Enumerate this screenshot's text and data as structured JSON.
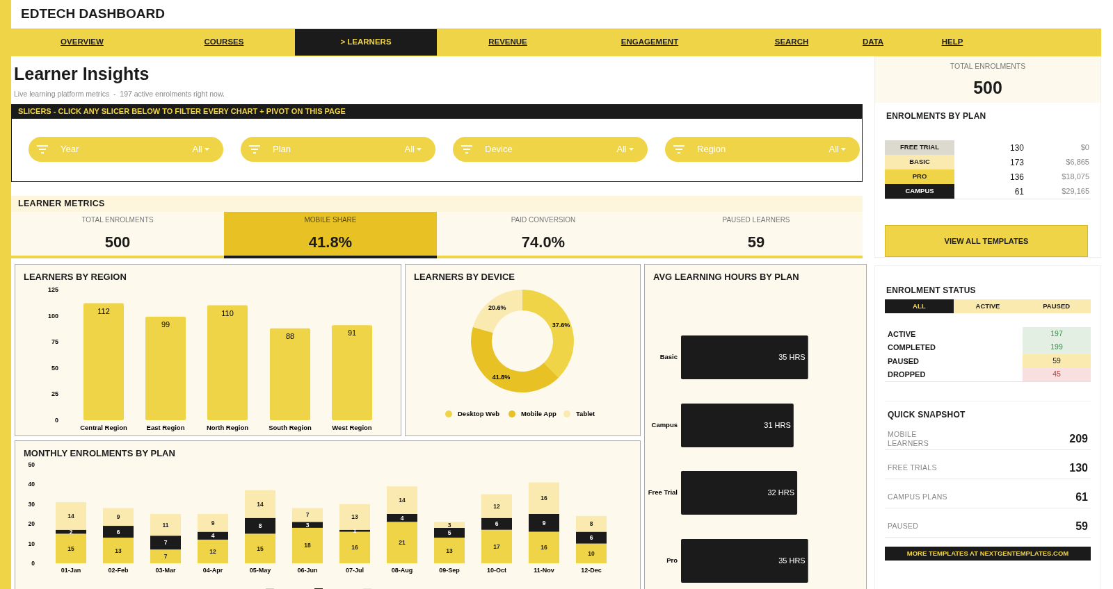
{
  "header": {
    "title": "EDTECH DASHBOARD"
  },
  "nav": [
    {
      "label": "OVERVIEW",
      "selected": false
    },
    {
      "label": "COURSES",
      "selected": false
    },
    {
      "label": "> LEARNERS",
      "selected": true
    },
    {
      "label": "REVENUE",
      "selected": false
    },
    {
      "label": "ENGAGEMENT",
      "selected": false
    },
    {
      "label": "SEARCH",
      "selected": false
    },
    {
      "label": "DATA",
      "selected": false
    },
    {
      "label": "HELP",
      "selected": false
    }
  ],
  "page": {
    "title": "Learner Insights",
    "subtitle": "Live learning platform metrics  -  197 active enrolments right now."
  },
  "slicers": {
    "heading": "SLICERS  -  CLICK ANY SLICER BELOW TO FILTER EVERY CHART + PIVOT ON THIS PAGE",
    "items": [
      {
        "label": "Year",
        "value": "All"
      },
      {
        "label": "Plan",
        "value": "All"
      },
      {
        "label": "Device",
        "value": "All"
      },
      {
        "label": "Region",
        "value": "All"
      }
    ]
  },
  "metrics": {
    "heading": "LEARNER METRICS",
    "tiles": [
      {
        "label": "TOTAL ENROLMENTS",
        "value": "500",
        "selected": false
      },
      {
        "label": "MOBILE SHARE",
        "value": "41.8%",
        "selected": true
      },
      {
        "label": "PAID CONVERSION",
        "value": "74.0%",
        "selected": false
      },
      {
        "label": "PAUSED LEARNERS",
        "value": "59",
        "selected": false
      }
    ]
  },
  "region_chart": {
    "title": "LEARNERS BY REGION",
    "chart_data": {
      "type": "bar",
      "categories": [
        "Central Region",
        "East Region",
        "North Region",
        "South Region",
        "West Region"
      ],
      "values": [
        112,
        99,
        110,
        88,
        91
      ],
      "ylim": [
        0,
        125
      ],
      "yticks": [
        0,
        25,
        50,
        75,
        100,
        125
      ],
      "data_labels": true
    }
  },
  "device_chart": {
    "title": "LEARNERS BY DEVICE",
    "chart_data": {
      "type": "donut",
      "categories": [
        "Desktop Web",
        "Mobile App",
        "Tablet"
      ],
      "values": [
        37.6,
        41.8,
        20.6
      ],
      "value_labels": [
        "37.6%",
        "41.8%",
        "20.6%"
      ],
      "legend": "bottom"
    }
  },
  "hours_chart": {
    "title": "AVG LEARNING HOURS BY PLAN",
    "chart_data": {
      "type": "bar",
      "orientation": "horizontal",
      "categories": [
        "Basic",
        "Campus",
        "Free Trial",
        "Pro"
      ],
      "values": [
        35,
        31,
        32,
        35
      ],
      "value_labels": [
        "35 HRS",
        "31 HRS",
        "32 HRS",
        "35 HRS"
      ]
    }
  },
  "monthly_chart": {
    "title": "MONTHLY ENROLMENTS BY PLAN",
    "chart_data": {
      "type": "bar",
      "stacked": true,
      "categories": [
        "01-Jan",
        "02-Feb",
        "03-Mar",
        "04-Apr",
        "05-May",
        "06-Jun",
        "07-Jul",
        "08-Aug",
        "09-Sep",
        "10-Oct",
        "11-Nov",
        "12-Dec"
      ],
      "ylim": [
        0,
        50
      ],
      "yticks": [
        0,
        10,
        20,
        30,
        40,
        50
      ],
      "data_labels": true,
      "series": [
        {
          "color": "#f0d447",
          "values": [
            15,
            13,
            7,
            12,
            15,
            18,
            16,
            21,
            13,
            17,
            16,
            10
          ]
        },
        {
          "color": "#1b1b1b",
          "values": [
            2,
            6,
            7,
            4,
            8,
            3,
            1,
            4,
            5,
            6,
            9,
            6
          ]
        },
        {
          "color": "#faeab0",
          "values": [
            14,
            9,
            11,
            9,
            14,
            7,
            13,
            14,
            3,
            12,
            16,
            8
          ]
        }
      ]
    }
  },
  "total": {
    "label": "TOTAL ENROLMENTS",
    "value": "500"
  },
  "plans": {
    "title": "ENROLMENTS BY PLAN",
    "rows": [
      {
        "name": "FREE TRIAL",
        "count": "130",
        "amount": "$0",
        "color": "#dcd9cf"
      },
      {
        "name": "BASIC",
        "count": "173",
        "amount": "$6,865",
        "color": "#faeab0"
      },
      {
        "name": "PRO",
        "count": "136",
        "amount": "$18,075",
        "color": "#f0d447"
      },
      {
        "name": "CAMPUS",
        "count": "61",
        "amount": "$29,165",
        "color": "#1b1b1b"
      }
    ]
  },
  "templates_button": {
    "label": "VIEW ALL TEMPLATES"
  },
  "status": {
    "title": "ENROLMENT STATUS",
    "tabs": [
      {
        "label": "ALL",
        "selected": true
      },
      {
        "label": "ACTIVE",
        "selected": false
      },
      {
        "label": "PAUSED",
        "selected": false
      }
    ],
    "rows": [
      {
        "label": "ACTIVE",
        "value": "197",
        "kind": "good"
      },
      {
        "label": "COMPLETED",
        "value": "199",
        "kind": "good"
      },
      {
        "label": "PAUSED",
        "value": "59",
        "kind": "warn"
      },
      {
        "label": "DROPPED",
        "value": "45",
        "kind": "bad"
      }
    ]
  },
  "snapshot": {
    "title": "QUICK SNAPSHOT",
    "rows": [
      {
        "label": "MOBILE LEARNERS",
        "value": "209"
      },
      {
        "label": "FREE TRIALS",
        "value": "130"
      },
      {
        "label": "CAMPUS PLANS",
        "value": "61"
      },
      {
        "label": "PAUSED",
        "value": "59"
      }
    ]
  },
  "footer": {
    "label": "MORE TEMPLATES AT NEXTGENTEMPLATES.COM"
  }
}
